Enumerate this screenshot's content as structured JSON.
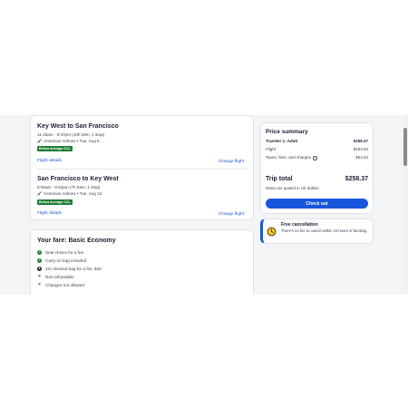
{
  "flights": [
    {
      "route": "Key West to San Francisco",
      "times": "11:18am - 6:47pm (10h 29m, 1 stop)",
      "airline": "American Airlines • Tue, Aug 5",
      "badge": "Below average CO₂",
      "details_link": "Flight details",
      "change_link": "Change flight"
    },
    {
      "route": "San Francisco to Key West",
      "times": "8:00am - 6:52pm (7h 52m, 1 stop)",
      "airline": "American Airlines • Tue, Aug 12",
      "badge": "Below average CO₂",
      "details_link": "Flight details",
      "change_link": "Change flight"
    }
  ],
  "fare": {
    "title": "Your fare: Basic Economy",
    "items": [
      {
        "icon": "check",
        "text": "Seat choice for a fee"
      },
      {
        "icon": "check",
        "text": "Carry-on bag included"
      },
      {
        "icon": "dollar",
        "text": "1st checked bag for a fee: $40"
      },
      {
        "icon": "x",
        "text": "Non-refundable"
      },
      {
        "icon": "x",
        "text": "Changes not allowed"
      }
    ]
  },
  "price_summary": {
    "title": "Price summary",
    "traveler_label": "Traveler 1: Adult",
    "traveler_value": "$258.37",
    "flight_label": "Flight",
    "flight_value": "$193.83",
    "taxes_label": "Taxes, fees, and charges",
    "taxes_value": "$64.54",
    "total_label": "Trip total",
    "total_value": "$258.37",
    "note": "Rates are quoted in US dollars",
    "button": "Check out"
  },
  "cancellation": {
    "title": "Free cancellation",
    "text": "There's no fee to cancel within 24 hours of booking."
  },
  "colors": {
    "accent": "#1a56db",
    "badge_green": "#1e7e34"
  }
}
